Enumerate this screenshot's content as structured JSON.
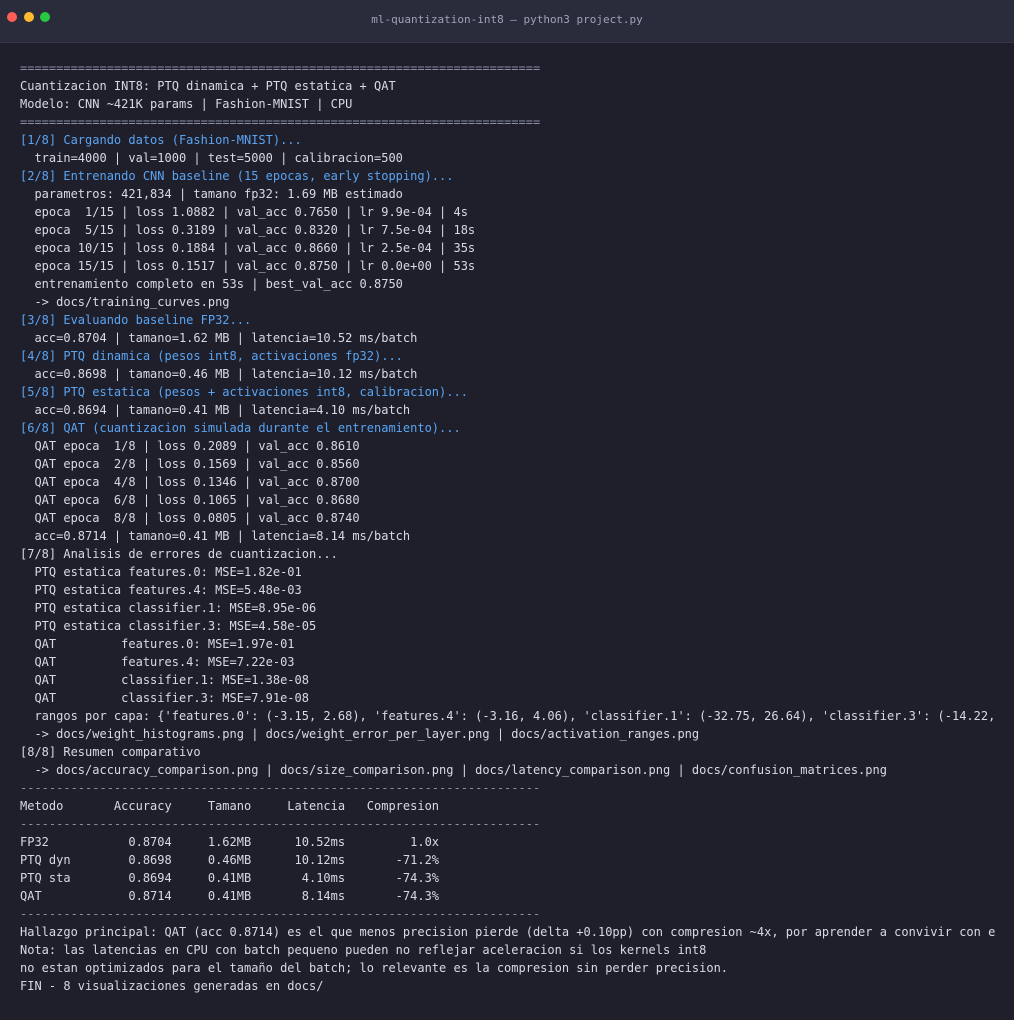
{
  "window": {
    "title": "ml-quantization-int8 — python3 project.py",
    "controls": [
      "close",
      "minimize",
      "maximize"
    ]
  },
  "colors": {
    "background": "#1e1f2b",
    "titlebar": "#2a2c3c",
    "text": "#d7dae6",
    "step_highlight": "#5ba4f2",
    "close": "#ff5f57",
    "minimize": "#febc2e",
    "maximize": "#28c840"
  },
  "terminal": {
    "lines": [
      "========================================================================",
      "Cuantizacion INT8: PTQ dinamica + PTQ estatica + QAT",
      "Modelo: CNN ~421K params | Fashion-MNIST | CPU",
      "========================================================================",
      "[1/8] Cargando datos (Fashion-MNIST)...",
      "  train=4000 | val=1000 | test=5000 | calibracion=500",
      "[2/8] Entrenando CNN baseline (15 epocas, early stopping)...",
      "  parametros: 421,834 | tamano fp32: 1.69 MB estimado",
      "  epoca  1/15 | loss 1.0882 | val_acc 0.7650 | lr 9.9e-04 | 4s",
      "  epoca  5/15 | loss 0.3189 | val_acc 0.8320 | lr 7.5e-04 | 18s",
      "  epoca 10/15 | loss 0.1884 | val_acc 0.8660 | lr 2.5e-04 | 35s",
      "  epoca 15/15 | loss 0.1517 | val_acc 0.8750 | lr 0.0e+00 | 53s",
      "  entrenamiento completo en 53s | best_val_acc 0.8750",
      "  -> docs/training_curves.png",
      "[3/8] Evaluando baseline FP32...",
      "  acc=0.8704 | tamano=1.62 MB | latencia=10.52 ms/batch",
      "[4/8] PTQ dinamica (pesos int8, activaciones fp32)...",
      "  acc=0.8698 | tamano=0.46 MB | latencia=10.12 ms/batch",
      "[5/8] PTQ estatica (pesos + activaciones int8, calibracion)...",
      "  acc=0.8694 | tamano=0.41 MB | latencia=4.10 ms/batch",
      "[6/8] QAT (cuantizacion simulada durante el entrenamiento)...",
      "  QAT epoca  1/8 | loss 0.2089 | val_acc 0.8610",
      "  QAT epoca  2/8 | loss 0.1569 | val_acc 0.8560",
      "  QAT epoca  4/8 | loss 0.1346 | val_acc 0.8700",
      "  QAT epoca  6/8 | loss 0.1065 | val_acc 0.8680",
      "  QAT epoca  8/8 | loss 0.0805 | val_acc 0.8740",
      "  acc=0.8714 | tamano=0.41 MB | latencia=8.14 ms/batch",
      "[7/8] Analisis de errores de cuantizacion...",
      "  PTQ estatica features.0: MSE=1.82e-01",
      "  PTQ estatica features.4: MSE=5.48e-03",
      "  PTQ estatica classifier.1: MSE=8.95e-06",
      "  PTQ estatica classifier.3: MSE=4.58e-05",
      "  QAT         features.0: MSE=1.97e-01",
      "  QAT         features.4: MSE=7.22e-03",
      "  QAT         classifier.1: MSE=1.38e-08",
      "  QAT         classifier.3: MSE=7.91e-08",
      "  rangos por capa: {'features.0': (-3.15, 2.68), 'features.4': (-3.16, 4.06), 'classifier.1': (-32.75, 26.64), 'classifier.3': (-14.22,",
      "  -> docs/weight_histograms.png | docs/weight_error_per_layer.png | docs/activation_ranges.png",
      "[8/8] Resumen comparativo",
      "  -> docs/accuracy_comparison.png | docs/size_comparison.png | docs/latency_comparison.png | docs/confusion_matrices.png",
      "------------------------------------------------------------------------",
      "Metodo       Accuracy     Tamano     Latencia   Compresion",
      "------------------------------------------------------------------------",
      "FP32           0.8704     1.62MB      10.52ms         1.0x",
      "PTQ dyn        0.8698     0.46MB      10.12ms       -71.2%",
      "PTQ sta        0.8694     0.41MB       4.10ms       -74.3%",
      "QAT            0.8714     0.41MB       8.14ms       -74.3%",
      "------------------------------------------------------------------------",
      "Hallazgo principal: QAT (acc 0.8714) es el que menos precision pierde (delta +0.10pp) con compresion ~4x, por aprender a convivir con e",
      "Nota: las latencias en CPU con batch pequeno pueden no reflejar aceleracion si los kernels int8",
      "no estan optimizados para el tamaño del batch; lo relevante es la compresion sin perder precision.",
      "FIN - 8 visualizaciones generadas en docs/"
    ]
  }
}
